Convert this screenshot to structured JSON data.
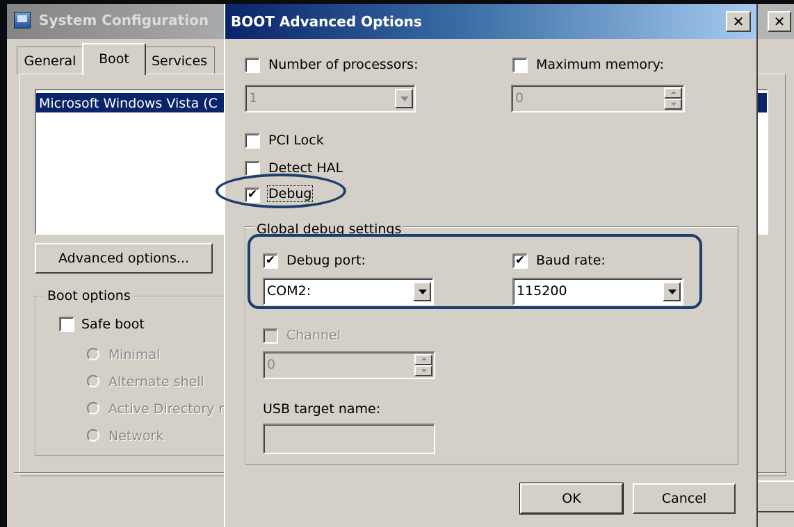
{
  "system_config": {
    "title": "System Configuration",
    "close_glyph": "✕",
    "tabs": [
      {
        "label": "General"
      },
      {
        "label": "Boot"
      },
      {
        "label": "Services"
      }
    ],
    "os_list": [
      "Microsoft Windows Vista (C"
    ],
    "advanced_options_label": "Advanced options...",
    "boot_options": {
      "legend": "Boot options",
      "safe_boot_label": "Safe boot",
      "radios": [
        "Minimal",
        "Alternate shell",
        "Active Directory r",
        "Network"
      ]
    }
  },
  "dialog": {
    "title": "BOOT Advanced Options",
    "close_glyph": "✕",
    "num_processors": {
      "label": "Number of processors:",
      "checked": false,
      "value": "1"
    },
    "max_memory": {
      "label": "Maximum memory:",
      "checked": false,
      "value": "0"
    },
    "pci_lock": {
      "label": "PCI Lock",
      "checked": false
    },
    "detect_hal": {
      "label": "Detect HAL",
      "checked": false
    },
    "debug": {
      "label": "Debug",
      "checked": true
    },
    "global_debug": {
      "legend": "Global debug settings",
      "debug_port": {
        "label": "Debug port:",
        "checked": true,
        "value": "COM2:"
      },
      "baud_rate": {
        "label": "Baud rate:",
        "checked": true,
        "value": "115200"
      },
      "channel": {
        "label": "Channel",
        "checked": false,
        "value": "0"
      },
      "usb_target": {
        "label": "USB target name:",
        "value": ""
      }
    },
    "ok_label": "OK",
    "cancel_label": "Cancel"
  },
  "check_glyph": "✔",
  "colors": {
    "dialog_titlebar": "#0a246a",
    "window_face": "#d4d0c8",
    "selection": "#0a246a",
    "annotation": "#1d3f6b"
  }
}
